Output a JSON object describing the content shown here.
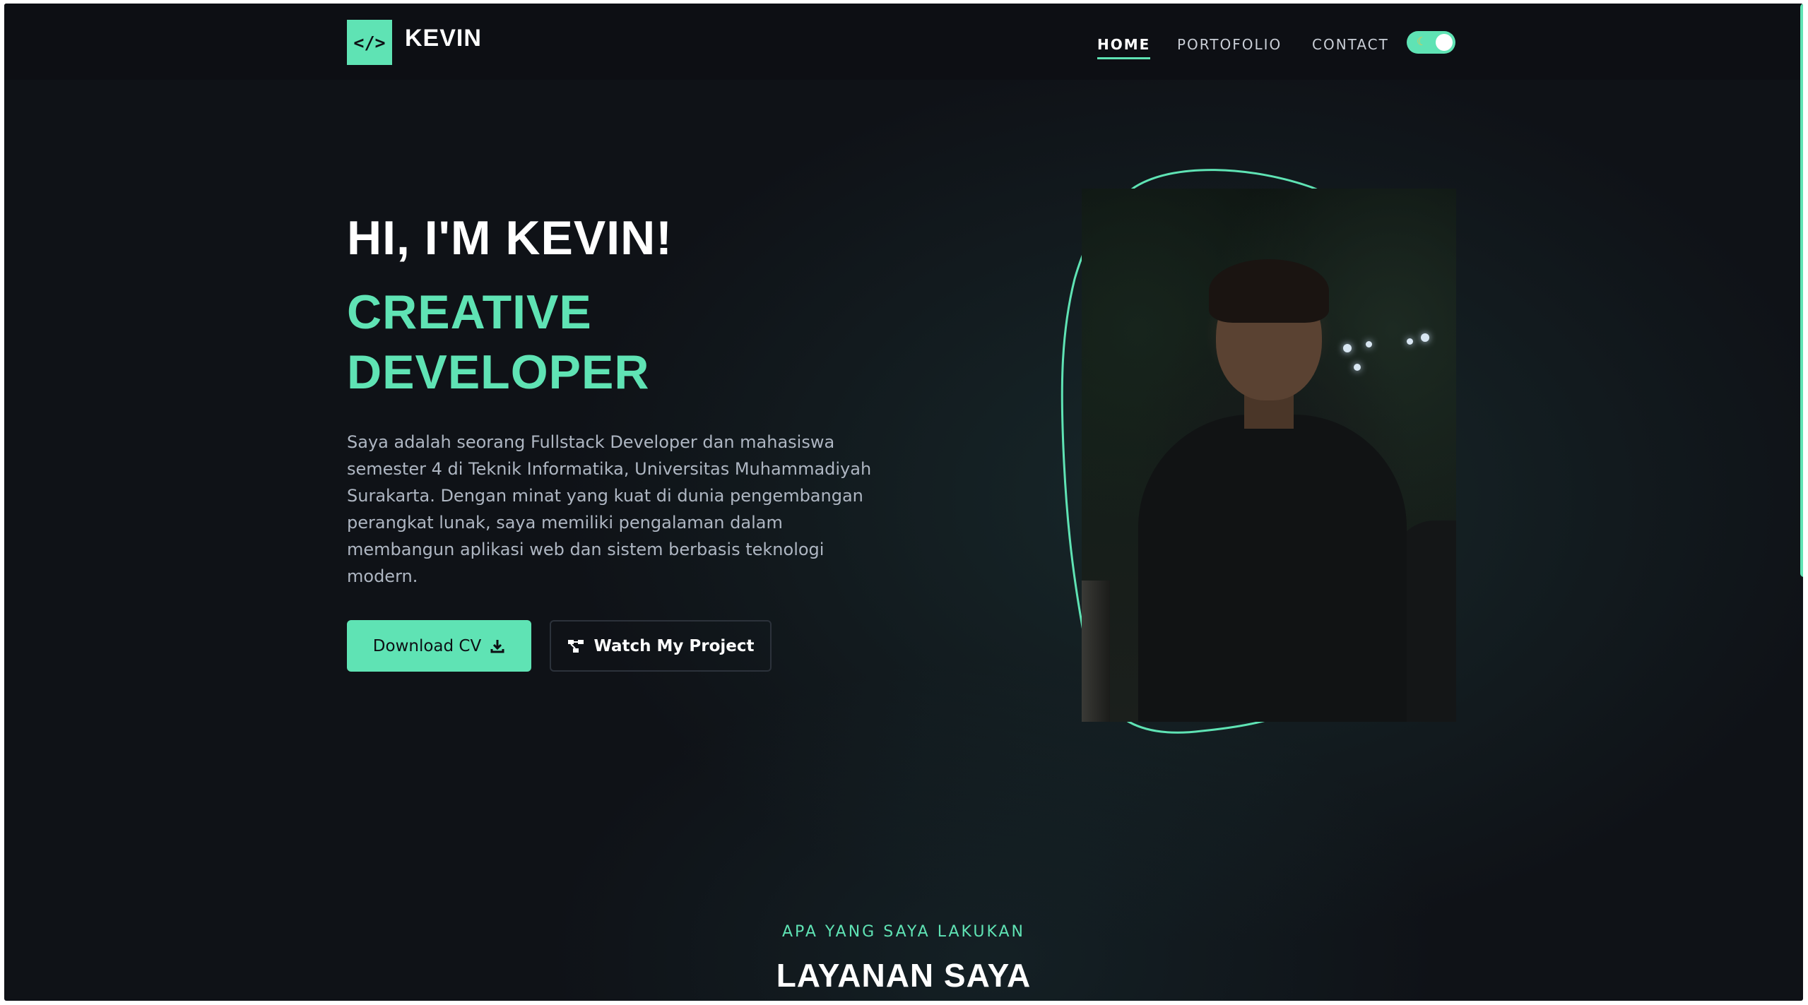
{
  "header": {
    "logo_icon": "</>",
    "logo_text": "KEVIN",
    "nav": [
      {
        "label": "HOME",
        "active": true
      },
      {
        "label": "PORTOFOLIO",
        "active": false
      },
      {
        "label": "CONTACT",
        "active": false
      }
    ],
    "theme_toggle": {
      "icon": "moon-icon",
      "state": "dark"
    }
  },
  "hero": {
    "greeting": "HI, I'M KEVIN!",
    "role_line1": "CREATIVE",
    "role_line2": "DEVELOPER",
    "description": "Saya adalah seorang Fullstack Developer dan mahasiswa semester 4 di Teknik Informatika, Universitas Muhammadiyah Surakarta. Dengan minat yang kuat di dunia pengembangan perangkat lunak, saya memiliki pengalaman dalam membangun aplikasi web dan sistem berbasis teknologi modern.",
    "primary_button": {
      "label": "Download CV",
      "icon": "download-icon"
    },
    "secondary_button": {
      "label": "Watch My Project",
      "icon": "project-icon"
    }
  },
  "section": {
    "kicker": "APA YANG SAYA LAKUKAN",
    "title": "LAYANAN SAYA"
  },
  "colors": {
    "accent": "#5fe3b4",
    "background": "#0f1217",
    "header_bg": "#0d0f14",
    "text_primary": "#ffffff",
    "text_muted": "#aeb6c2"
  }
}
